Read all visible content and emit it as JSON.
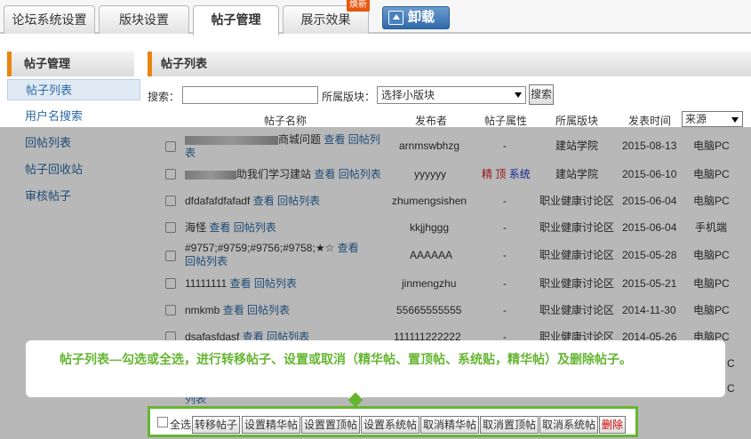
{
  "tabs": [
    {
      "label": "论坛系统设置",
      "badge": ""
    },
    {
      "label": "版块设置",
      "badge": ""
    },
    {
      "label": "帖子管理",
      "badge": ""
    },
    {
      "label": "展示效果",
      "badge": "焕新"
    }
  ],
  "uninstall_label": "卸载",
  "sidebar": {
    "title": "帖子管理",
    "items": [
      "帖子列表",
      "用户名搜索",
      "回帖列表",
      "帖子回收站",
      "审核帖子"
    ]
  },
  "main": {
    "title": "帖子列表",
    "search_label": "搜索：",
    "board_label": "所属版块：",
    "board_selected": "选择小版块",
    "search_button": "搜索",
    "columns": [
      "帖子名称",
      "发布者",
      "帖子属性",
      "所属版块",
      "发表时间"
    ],
    "source_selected": "来源"
  },
  "rows": [
    {
      "title": "商城问题",
      "blurred": true,
      "links": [
        "查看",
        "回帖列表"
      ],
      "author": "arnmswbhzg",
      "attr": "-",
      "board": "建站学院",
      "date": "2015-08-13",
      "source": "电脑PC"
    },
    {
      "title": "助我们学习建站",
      "blurred": true,
      "links": [
        "查看",
        "回帖列表"
      ],
      "author": "yyyyyy",
      "attr_tags": [
        "精",
        "顶",
        "系统"
      ],
      "board": "建站学院",
      "date": "2015-06-10",
      "source": "电脑PC"
    },
    {
      "title": "dfdafafdfafadf",
      "links": [
        "查看",
        "回帖列表"
      ],
      "author": "zhumengsishen",
      "attr": "-",
      "board": "职业健康讨论区",
      "date": "2015-06-04",
      "source": "电脑PC"
    },
    {
      "title": "海怪",
      "links": [
        "查看",
        "回帖列表"
      ],
      "author": "kkjjhggg",
      "attr": "-",
      "board": "职业健康讨论区",
      "date": "2015-06-04",
      "source": "手机端"
    },
    {
      "title": "#9757;#9759;#9756;#9758;★☆",
      "links": [
        "查看",
        "回帖列表"
      ],
      "author": "AAAAAA",
      "attr": "-",
      "board": "职业健康讨论区",
      "date": "2015-05-28",
      "source": "电脑PC"
    },
    {
      "title": "11111111",
      "links": [
        "查看",
        "回帖列表"
      ],
      "author": "jinmengzhu",
      "attr": "-",
      "board": "职业健康讨论区",
      "date": "2015-05-21",
      "source": "电脑PC"
    },
    {
      "title": "nmkmb",
      "links": [
        "查看",
        "回帖列表"
      ],
      "author": "55665555555",
      "attr": "-",
      "board": "职业健康讨论区",
      "date": "2014-11-30",
      "source": "电脑PC"
    },
    {
      "title": "dsafasfdasf",
      "links": [
        "查看",
        "回帖列表"
      ],
      "author": "111111222222",
      "attr": "-",
      "board": "职业健康讨论区",
      "date": "2014-05-26",
      "source": "电脑PC"
    }
  ],
  "partial_row_text": "列表",
  "edge_chars": [
    "C",
    "C"
  ],
  "tooltip": "帖子列表—勾选或全选，进行转移帖子、设置或取消（精华帖、置顶帖、系统贴，精华帖）及删除帖子。",
  "actions": {
    "select_all_label": "全选",
    "buttons": [
      "转移帖子",
      "设置精华帖",
      "设置置顶帖",
      "设置系统帖",
      "取消精华帖",
      "取消置顶帖",
      "取消系统帖",
      "删除"
    ]
  },
  "colors": {
    "accent_orange": "#e8860f",
    "tooltip_green": "#66b532",
    "link_blue": "#2c6aa5",
    "badge": "#e8560f"
  }
}
